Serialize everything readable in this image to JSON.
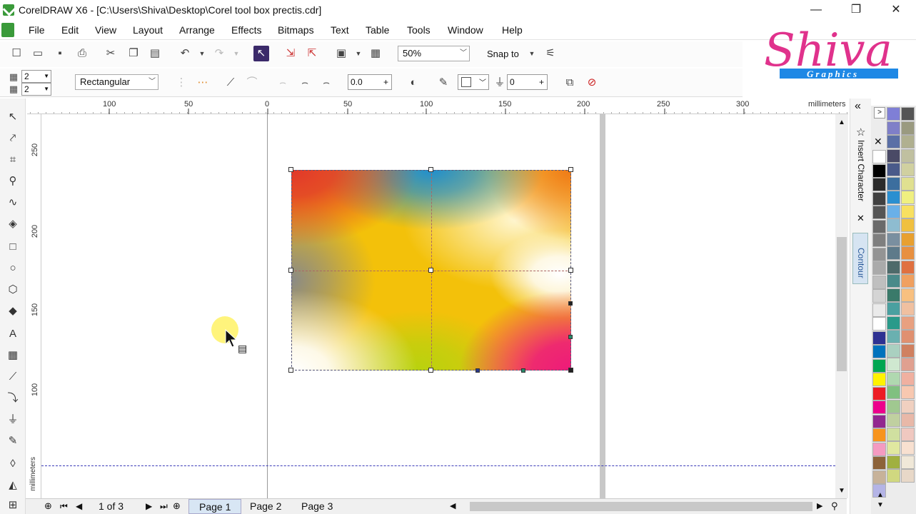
{
  "window": {
    "title": "CorelDRAW X6 - [C:\\Users\\Shiva\\Desktop\\Corel tool box prectis.cdr]",
    "minimize_glyph": "—",
    "restore_glyph": "❐",
    "close_glyph": "✕"
  },
  "menu": [
    "File",
    "Edit",
    "View",
    "Layout",
    "Arrange",
    "Effects",
    "Bitmaps",
    "Text",
    "Table",
    "Tools",
    "Window",
    "Help"
  ],
  "toolbar": {
    "zoom_value": "50%",
    "snap_label": "Snap to"
  },
  "propbar": {
    "rows_value": "2",
    "cols_value": "2",
    "shape_select": "Rectangular",
    "x_offset": "0.0",
    "transparency_value": "0"
  },
  "logo": {
    "name": "Shiva",
    "sub": "Graphics"
  },
  "ruler": {
    "h_labels": [
      "100",
      "50",
      "0",
      "50",
      "100",
      "150",
      "200",
      "250",
      "300"
    ],
    "units": "millimeters",
    "v_labels": [
      "250",
      "200",
      "150",
      "100"
    ],
    "v_units": "millimeters"
  },
  "pages": {
    "counter": "1 of 3",
    "tabs": [
      "Page 1",
      "Page 2",
      "Page 3"
    ]
  },
  "dockers": {
    "insert_character": "Insert Character",
    "contour": "Contour",
    "collapse_glyph": "«"
  },
  "palette_colors": {
    "col1": [
      "#ffffff",
      "#000000",
      "#2b2b2b",
      "#404040",
      "#555555",
      "#6a6a6a",
      "#7f7f7f",
      "#949494",
      "#aaaaaa",
      "#bfbfbf",
      "#d4d4d4",
      "#eaeaea",
      "#ffffff",
      "#2e3192",
      "#0072bc",
      "#00a651",
      "#fff200",
      "#ed1c24",
      "#ec008c",
      "#92278f",
      "#f7941d",
      "#f49ac1",
      "#8c6239",
      "#c7b299",
      "#b4b4e6",
      "#c8d96f",
      "#9aa6e6"
    ],
    "col2": [
      "#7f7fd6",
      "#7f7fc8",
      "#5a6fa6",
      "#4a4a66",
      "#4a5a8a",
      "#3c6e9e",
      "#2a8fd0",
      "#6ab0e8",
      "#8ebcd0",
      "#7a8fa0",
      "#5e7a8a",
      "#4e6a6a",
      "#4a8a8a",
      "#3a7a6a",
      "#4aa0a0",
      "#2a9a8a",
      "#6ab0b0",
      "#aad0c0",
      "#cfe8d0",
      "#b0d8b0",
      "#80c080",
      "#a0c890",
      "#c0d0a0",
      "#d0e0a0",
      "#e0e8a0",
      "#a0b040",
      "#d0d880"
    ],
    "col3": [
      "#555555",
      "#9a9a80",
      "#b0b090",
      "#c0c0a0",
      "#d0d0a0",
      "#e0e090",
      "#f0f080",
      "#f8e060",
      "#f0c040",
      "#e8a030",
      "#e89040",
      "#e07040",
      "#f0a060",
      "#f8c080",
      "#f0c0a0",
      "#e8a080",
      "#e09070",
      "#d08060",
      "#e0a090",
      "#f0b0a0",
      "#f8c8b0",
      "#f0d0c0",
      "#e8b8a8",
      "#f0c8c0",
      "#f8e0d0",
      "#f0e8d8",
      "#e8d8c8"
    ]
  }
}
